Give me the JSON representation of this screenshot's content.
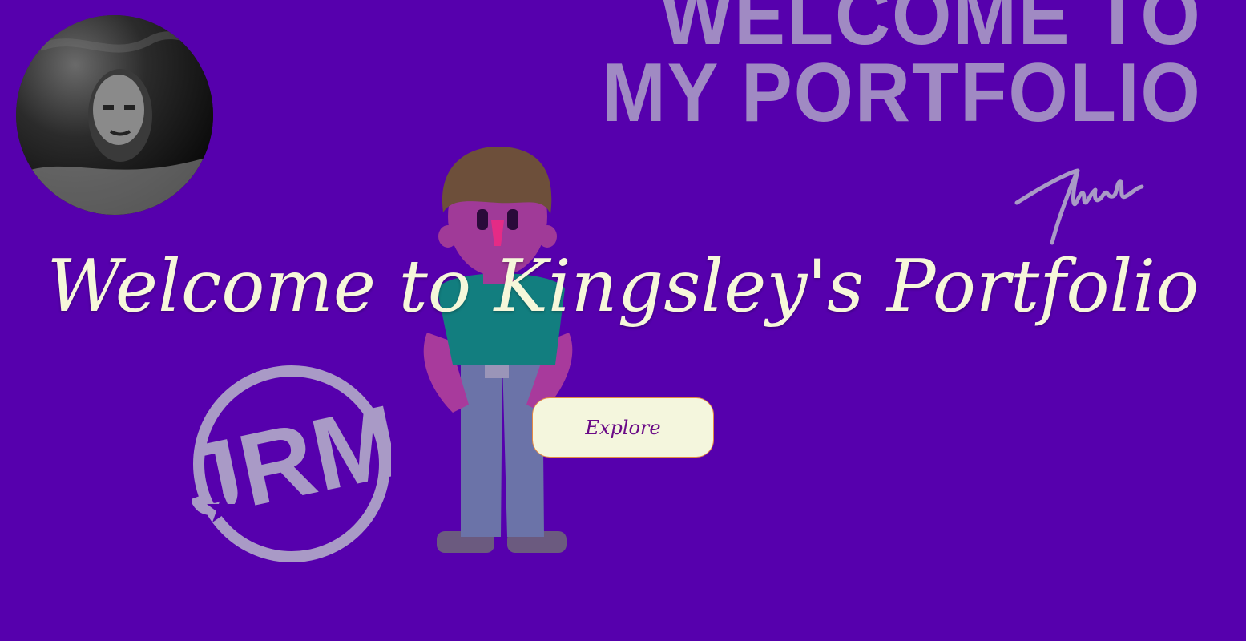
{
  "background": {
    "color": "#5600ad",
    "heading_lines": [
      "WELCOME TO",
      "MY PORTFOLIO"
    ],
    "monogram": "JRM"
  },
  "hero": {
    "title": "Welcome to Kingsley's Portfolio",
    "title_color": "#f6f7da"
  },
  "explore_button": {
    "label": "Explore",
    "text_color": "#6a0a86",
    "background": "#f4f6dd"
  },
  "icons": {
    "avatar": "profile-photo",
    "character": "person-illustration",
    "signature": "signature-mark",
    "monogram": "monogram-seal"
  }
}
